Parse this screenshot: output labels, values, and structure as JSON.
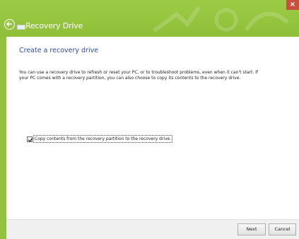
{
  "window": {
    "title": "Recovery Drive",
    "close_glyph": "×",
    "accent_color": "#93c23e"
  },
  "page": {
    "heading": "Create a recovery drive",
    "description": "You can use a recovery drive to refresh or reset your PC, or to troubleshoot problems, even when it can't start. If your PC comes with a recovery partition, you can also choose to copy its contents to the recovery drive.",
    "copy_option": {
      "label": "Copy contents from the recovery partition to the recovery drive.",
      "checked": true
    }
  },
  "footer": {
    "next_label": "Next",
    "cancel_label": "Cancel"
  },
  "icons": {
    "back": "back-arrow-icon",
    "drive": "drive-icon",
    "check": "checkmark-icon"
  }
}
